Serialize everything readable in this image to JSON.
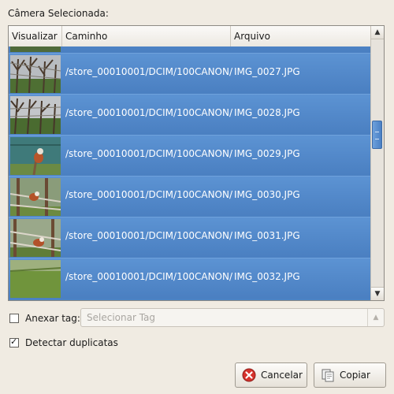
{
  "dialog": {
    "title": "Câmera Selecionada:"
  },
  "table": {
    "columns": [
      "Visualizar",
      "Caminho",
      "Arquivo"
    ],
    "rows": [
      {
        "path": "/store_00010001/DCIM/100CANON/",
        "file": "IMG_0027.JPG"
      },
      {
        "path": "/store_00010001/DCIM/100CANON/",
        "file": "IMG_0028.JPG"
      },
      {
        "path": "/store_00010001/DCIM/100CANON/",
        "file": "IMG_0029.JPG"
      },
      {
        "path": "/store_00010001/DCIM/100CANON/",
        "file": "IMG_0030.JPG"
      },
      {
        "path": "/store_00010001/DCIM/100CANON/",
        "file": "IMG_0031.JPG"
      },
      {
        "path": "/store_00010001/DCIM/100CANON/",
        "file": "IMG_0032.JPG"
      }
    ],
    "selection_color": "#4f86c7"
  },
  "options": {
    "attach_tag_label": "Anexar tag:",
    "attach_tag_checked": false,
    "tag_placeholder": "Selecionar Tag",
    "detect_duplicates_label": "Detectar duplicatas",
    "detect_duplicates_checked": true
  },
  "buttons": {
    "cancel": "Cancelar",
    "cancel_icon": "cancel-icon",
    "copy": "Copiar",
    "copy_icon": "copy-icon"
  }
}
